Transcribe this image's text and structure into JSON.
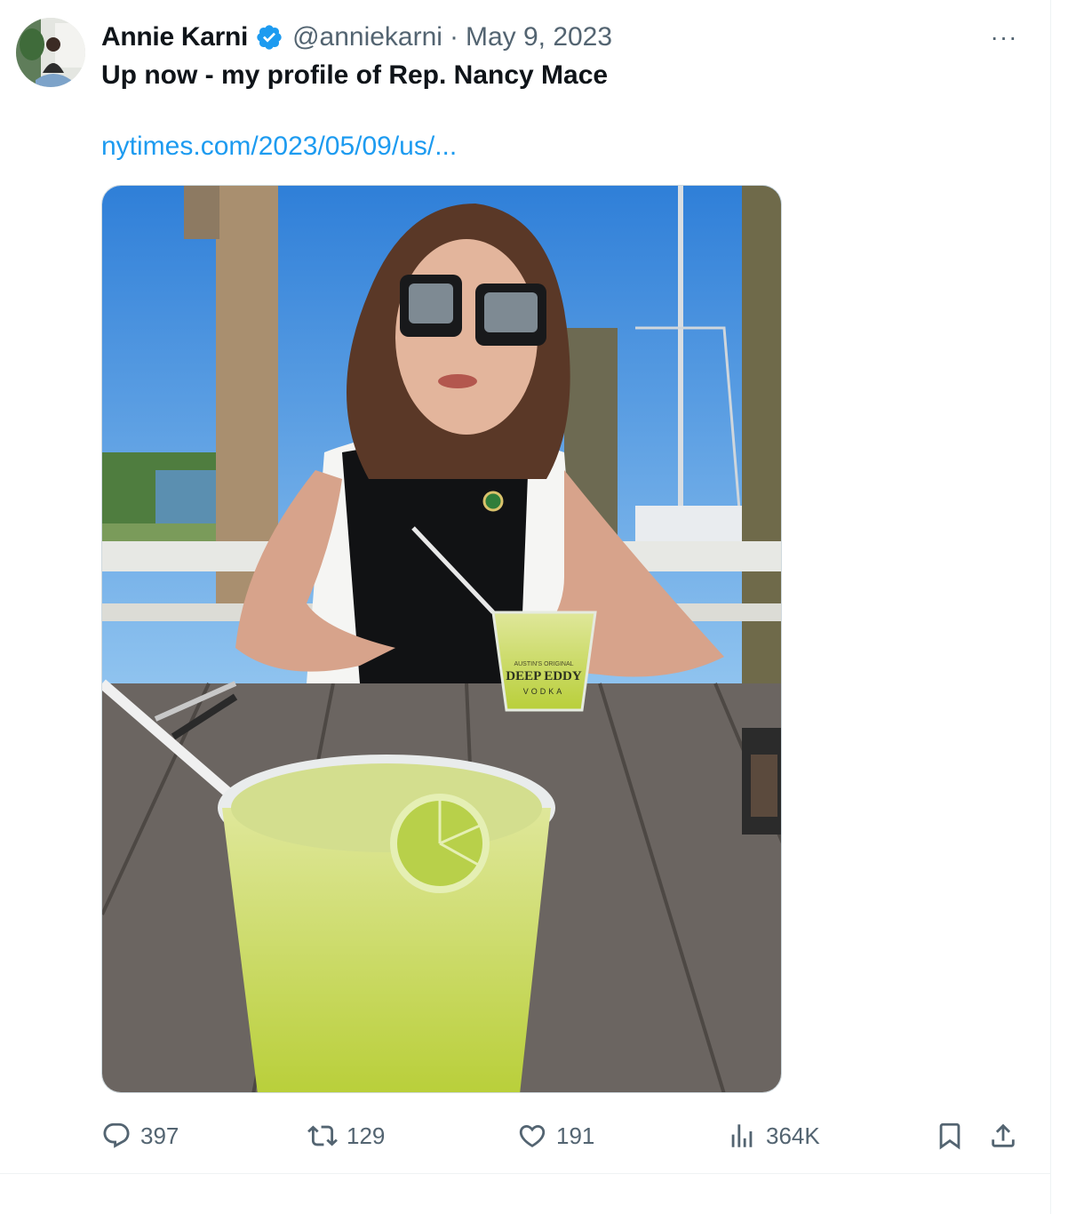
{
  "tweet": {
    "author_name": "Annie Karni",
    "handle": "@anniekarni",
    "separator": "·",
    "date": "May 9, 2023",
    "more_label": "···",
    "text": "Up now - my profile of Rep. Nancy Mace",
    "link_text": "nytimes.com/2023/05/09/us/...",
    "media_cup_text_top": "AUSTIN'S ORIGINAL",
    "media_cup_text_brand": "DEEP EDDY",
    "media_cup_text_sub": "VODKA"
  },
  "actions": {
    "replies": "397",
    "retweets": "129",
    "likes": "191",
    "views": "364K"
  },
  "colors": {
    "accent": "#1d9bf0",
    "secondary_text": "#536471",
    "verified": "#1d9bf0"
  },
  "icons": [
    "verified-badge-icon",
    "more-icon",
    "reply-icon",
    "retweet-icon",
    "like-icon",
    "views-icon",
    "bookmark-icon",
    "share-icon"
  ]
}
